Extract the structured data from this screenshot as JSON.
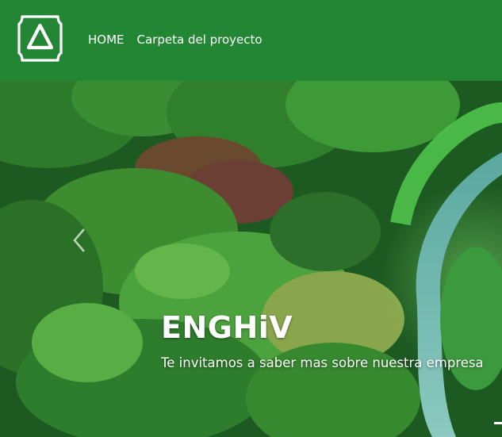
{
  "header": {
    "background_color": "#238634",
    "logo_icon": "triangle-in-square-logo",
    "nav": [
      {
        "label": "HOME"
      },
      {
        "label": "Carpeta del proyecto"
      }
    ]
  },
  "hero": {
    "image": "aerial-forest-with-winding-road",
    "title": "ENGHiV",
    "text": "Te invitamos a saber mas sobre nuestra empresa",
    "prev_icon": "chevron-left-icon"
  }
}
